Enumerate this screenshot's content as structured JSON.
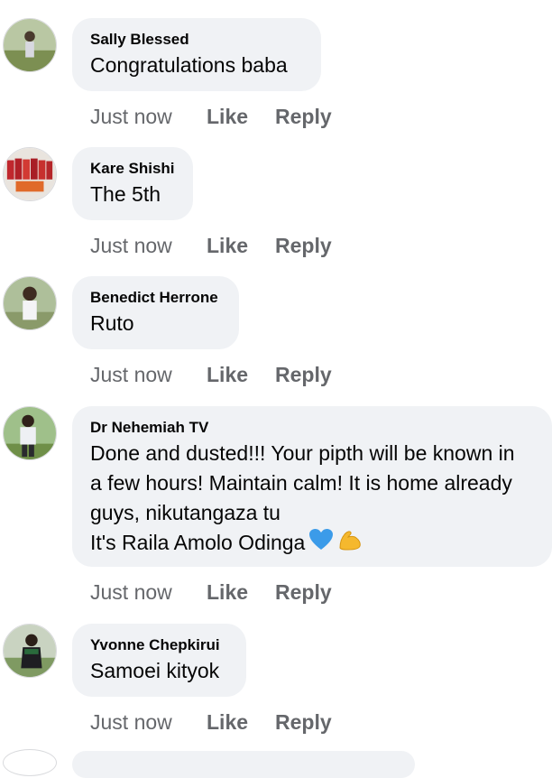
{
  "comments": [
    {
      "author": "Sally Blessed",
      "lines": [
        "Congratulations baba"
      ],
      "time": "Just now",
      "like_label": "Like",
      "reply_label": "Reply",
      "avatar_icon": "avatar-photo"
    },
    {
      "author": "Kare Shishi",
      "lines": [
        "The 5th"
      ],
      "time": "Just now",
      "like_label": "Like",
      "reply_label": "Reply",
      "avatar_icon": "avatar-photo"
    },
    {
      "author": "Benedict Herrone",
      "lines": [
        "Ruto"
      ],
      "time": "Just now",
      "like_label": "Like",
      "reply_label": "Reply",
      "avatar_icon": "avatar-photo"
    },
    {
      "author": "Dr Nehemiah TV",
      "lines": [
        "Done and dusted!!! Your pipth will be known in",
        "a few hours! Maintain calm! It is home already",
        "guys, nikutangaza tu",
        "It's Raila Amolo Odinga"
      ],
      "emoji": [
        "blue-heart-icon",
        "flexed-biceps-icon"
      ],
      "time": "Just now",
      "like_label": "Like",
      "reply_label": "Reply",
      "avatar_icon": "avatar-photo"
    },
    {
      "author": "Yvonne Chepkirui",
      "lines": [
        "Samoei kityok"
      ],
      "time": "Just now",
      "like_label": "Like",
      "reply_label": "Reply",
      "avatar_icon": "avatar-photo"
    }
  ],
  "colors": {
    "bubble": "#f0f2f5",
    "author_text": "#050505",
    "meta_text": "#65676b",
    "heart": "#3b9be9",
    "muscle": "#f5b82e"
  }
}
